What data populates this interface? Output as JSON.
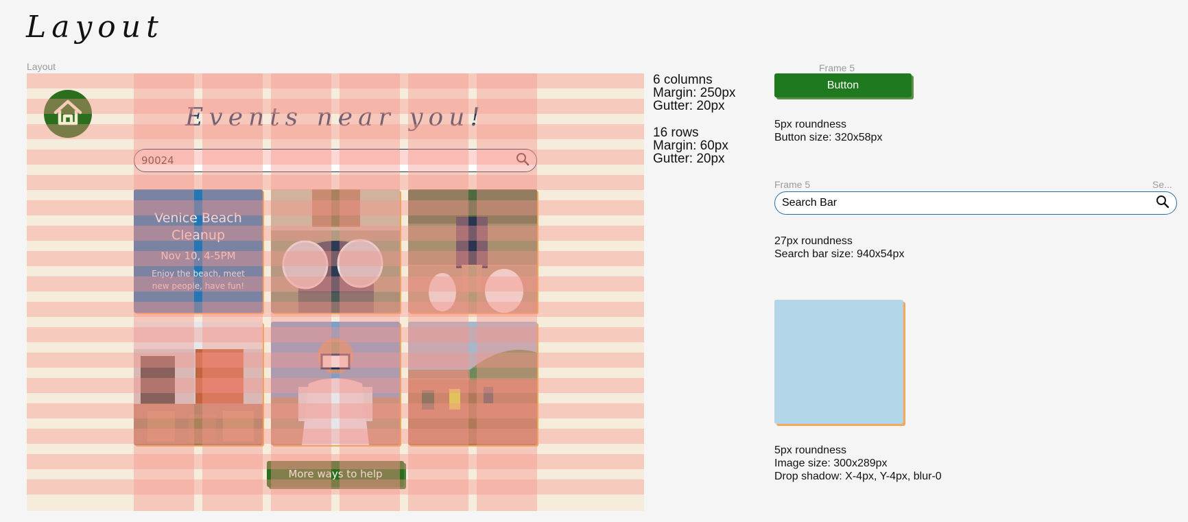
{
  "page": {
    "title": "Layout"
  },
  "frame_labels": {
    "layout": "Layout",
    "button_frame": "Frame 5",
    "search_frame": "Frame 5",
    "search_frame_right": "Se..."
  },
  "design": {
    "heading": "Events near you!",
    "search_value": "90024",
    "cards": [
      {
        "type": "text",
        "title": "Venice Beach Cleanup",
        "date": "Nov 10, 4-5PM",
        "description": "Enjoy the beach, meet new people, have fun!"
      },
      {
        "type": "photo",
        "name": "photo-volunteer-holding-containers"
      },
      {
        "type": "photo",
        "name": "photo-volunteer-carrying-trash-bags"
      },
      {
        "type": "photo",
        "name": "photo-volunteers-packing-bags"
      },
      {
        "type": "photo",
        "name": "photo-masked-volunteer-holding-bottles"
      },
      {
        "type": "photo",
        "name": "photo-volunteers-cleaning-shoreline"
      }
    ],
    "more_button": "More ways to help",
    "home_icon": "home-icon",
    "search_icon": "search-icon"
  },
  "grid_specs": {
    "columns": "6 columns",
    "col_margin": "Margin: 250px",
    "col_gutter": "Gutter: 20px",
    "rows": "16 rows",
    "row_margin": "Margin: 60px",
    "row_gutter": "Gutter: 20px"
  },
  "components": {
    "button_label": "Button",
    "button_roundness": "5px roundness",
    "button_size": "Button size: 320x58px",
    "search_placeholder": "Search Bar",
    "search_roundness": "27px roundness",
    "search_size": "Search bar size: 940x54px",
    "image_roundness": "5px roundness",
    "image_size": "Image size: 300x289px",
    "image_shadow": "Drop shadow: X-4px, Y-4px, blur-0"
  },
  "colors": {
    "frame_bg": "#f6ecdc",
    "grid_overlay": "#f6968c",
    "primary_green": "#2a6e1e",
    "card_blue": "#2476b4",
    "heading_navy": "#1d3c5c",
    "image_placeholder": "#b3d5e8",
    "shadow_orange": "#f3a64a"
  }
}
